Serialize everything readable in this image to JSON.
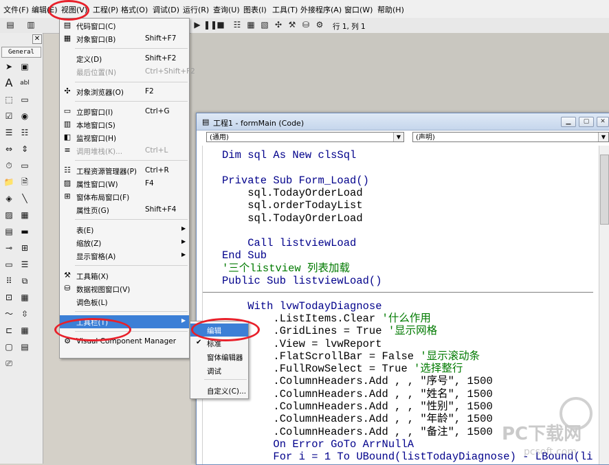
{
  "menubar": {
    "items": [
      "文件(F)",
      "编辑(E)",
      "视图(V)",
      "工程(P)",
      "格式(O)",
      "调试(D)",
      "运行(R)",
      "查询(U)",
      "图表(I)",
      "工具(T)",
      "外接程序(A)",
      "窗口(W)",
      "帮助(H)"
    ]
  },
  "toolbar": {
    "position_label": "行 1, 列 1"
  },
  "toolbox": {
    "tab_label": "General"
  },
  "view_menu": {
    "items": [
      {
        "label": "代码窗口(C)",
        "shortcut": "",
        "icon": "code-window-icon"
      },
      {
        "label": "对象窗口(B)",
        "shortcut": "Shift+F7",
        "icon": "object-window-icon"
      },
      {
        "label": "定义(D)",
        "shortcut": "Shift+F2",
        "icon": ""
      },
      {
        "label": "最后位置(N)",
        "shortcut": "Ctrl+Shift+F2",
        "icon": "",
        "disabled": true
      },
      {
        "label": "对象浏览器(O)",
        "shortcut": "F2",
        "icon": "object-browser-icon"
      },
      {
        "label": "立即窗口(I)",
        "shortcut": "Ctrl+G",
        "icon": "immediate-window-icon"
      },
      {
        "label": "本地窗口(S)",
        "shortcut": "",
        "icon": "locals-window-icon"
      },
      {
        "label": "监视窗口(H)",
        "shortcut": "",
        "icon": "watch-window-icon"
      },
      {
        "label": "调用堆栈(K)...",
        "shortcut": "Ctrl+L",
        "icon": "call-stack-icon",
        "disabled": true
      },
      {
        "label": "工程资源管理器(P)",
        "shortcut": "Ctrl+R",
        "icon": "project-explorer-icon"
      },
      {
        "label": "属性窗口(W)",
        "shortcut": "F4",
        "icon": "properties-window-icon"
      },
      {
        "label": "窗体布局窗口(F)",
        "shortcut": "",
        "icon": "form-layout-icon"
      },
      {
        "label": "属性页(G)",
        "shortcut": "Shift+F4",
        "icon": ""
      },
      {
        "label": "表(E)",
        "shortcut": "",
        "icon": "",
        "submenu": true
      },
      {
        "label": "缩放(Z)",
        "shortcut": "",
        "icon": "",
        "submenu": true
      },
      {
        "label": "显示窗格(A)",
        "shortcut": "",
        "icon": "",
        "submenu": true
      },
      {
        "label": "工具箱(X)",
        "shortcut": "",
        "icon": "toolbox-icon"
      },
      {
        "label": "数据视图窗口(V)",
        "shortcut": "",
        "icon": "data-view-icon"
      },
      {
        "label": "调色板(L)",
        "shortcut": "",
        "icon": ""
      },
      {
        "label": "工具栏(T)",
        "shortcut": "",
        "icon": "",
        "submenu": true,
        "highlighted": true
      },
      {
        "label": "Visual Component Manager",
        "shortcut": "",
        "icon": "component-manager-icon"
      }
    ]
  },
  "toolbar_submenu": {
    "items": [
      {
        "label": "编辑",
        "checked": false,
        "highlighted": true
      },
      {
        "label": "标准",
        "checked": true
      },
      {
        "label": "窗体编辑器",
        "checked": false
      },
      {
        "label": "调试",
        "checked": false
      },
      {
        "label": "自定义(C)...",
        "checked": false
      }
    ]
  },
  "code_window": {
    "title": "工程1 - formMain (Code)",
    "object_combo": "(通用)",
    "proc_combo": "(声明)",
    "lines": [
      [
        {
          "t": "Dim sql As New clsSql",
          "c": "kw"
        }
      ],
      [
        {
          "t": "",
          "c": ""
        }
      ],
      [
        {
          "t": "Private Sub Form_Load()",
          "c": "kw"
        }
      ],
      [
        {
          "t": "    sql.TodayOrderLoad",
          "c": ""
        }
      ],
      [
        {
          "t": "    sql.orderTodayList",
          "c": ""
        }
      ],
      [
        {
          "t": "    sql.TodayOrderLoad",
          "c": ""
        }
      ],
      [
        {
          "t": "",
          "c": ""
        }
      ],
      [
        {
          "t": "    Call listviewLoad",
          "c": "kw"
        }
      ],
      [
        {
          "t": "End Sub",
          "c": "kw"
        }
      ],
      [
        {
          "t": "'三个listview 列表加载",
          "c": "cm"
        }
      ],
      [
        {
          "t": "Public Sub listviewLoad()",
          "c": "kw"
        }
      ],
      [
        {
          "t": "",
          "c": ""
        }
      ],
      [
        {
          "t": "    With lvwTodayDiagnose",
          "c": "kw"
        }
      ],
      [
        {
          "t": "        .ListItems.Clear ",
          "c": ""
        },
        {
          "t": "'什么作用",
          "c": "cm"
        }
      ],
      [
        {
          "t": "        .GridLines = True ",
          "c": ""
        },
        {
          "t": "'显示网格",
          "c": "cm"
        }
      ],
      [
        {
          "t": "        .View = lvwReport",
          "c": ""
        }
      ],
      [
        {
          "t": "        .FlatScrollBar = False ",
          "c": ""
        },
        {
          "t": "'显示滚动条",
          "c": "cm"
        }
      ],
      [
        {
          "t": "        .FullRowSelect = True ",
          "c": ""
        },
        {
          "t": "'选择整行",
          "c": "cm"
        }
      ],
      [
        {
          "t": "        .ColumnHeaders.Add , , \"序号\", 1500",
          "c": ""
        }
      ],
      [
        {
          "t": "        .ColumnHeaders.Add , , \"姓名\", 1500",
          "c": ""
        }
      ],
      [
        {
          "t": "        .ColumnHeaders.Add , , \"性别\", 1500",
          "c": ""
        }
      ],
      [
        {
          "t": "        .ColumnHeaders.Add , , \"年龄\", 1500",
          "c": ""
        }
      ],
      [
        {
          "t": "        .ColumnHeaders.Add , , \"备注\", 1500",
          "c": ""
        }
      ],
      [
        {
          "t": "        On Error GoTo ArrNullA",
          "c": "kw"
        }
      ],
      [
        {
          "t": "        For i = 1 To UBound(listTodayDiagnose) - LBound(li",
          "c": "kw"
        }
      ]
    ]
  },
  "watermark": {
    "text1": "PC下载网",
    "text2": "pcsoft.com"
  },
  "colors": {
    "menu_highlight": "#3c7fd6",
    "annotation_red": "#e8202a",
    "comment_green": "#007a00",
    "keyword_blue": "#00008b"
  }
}
